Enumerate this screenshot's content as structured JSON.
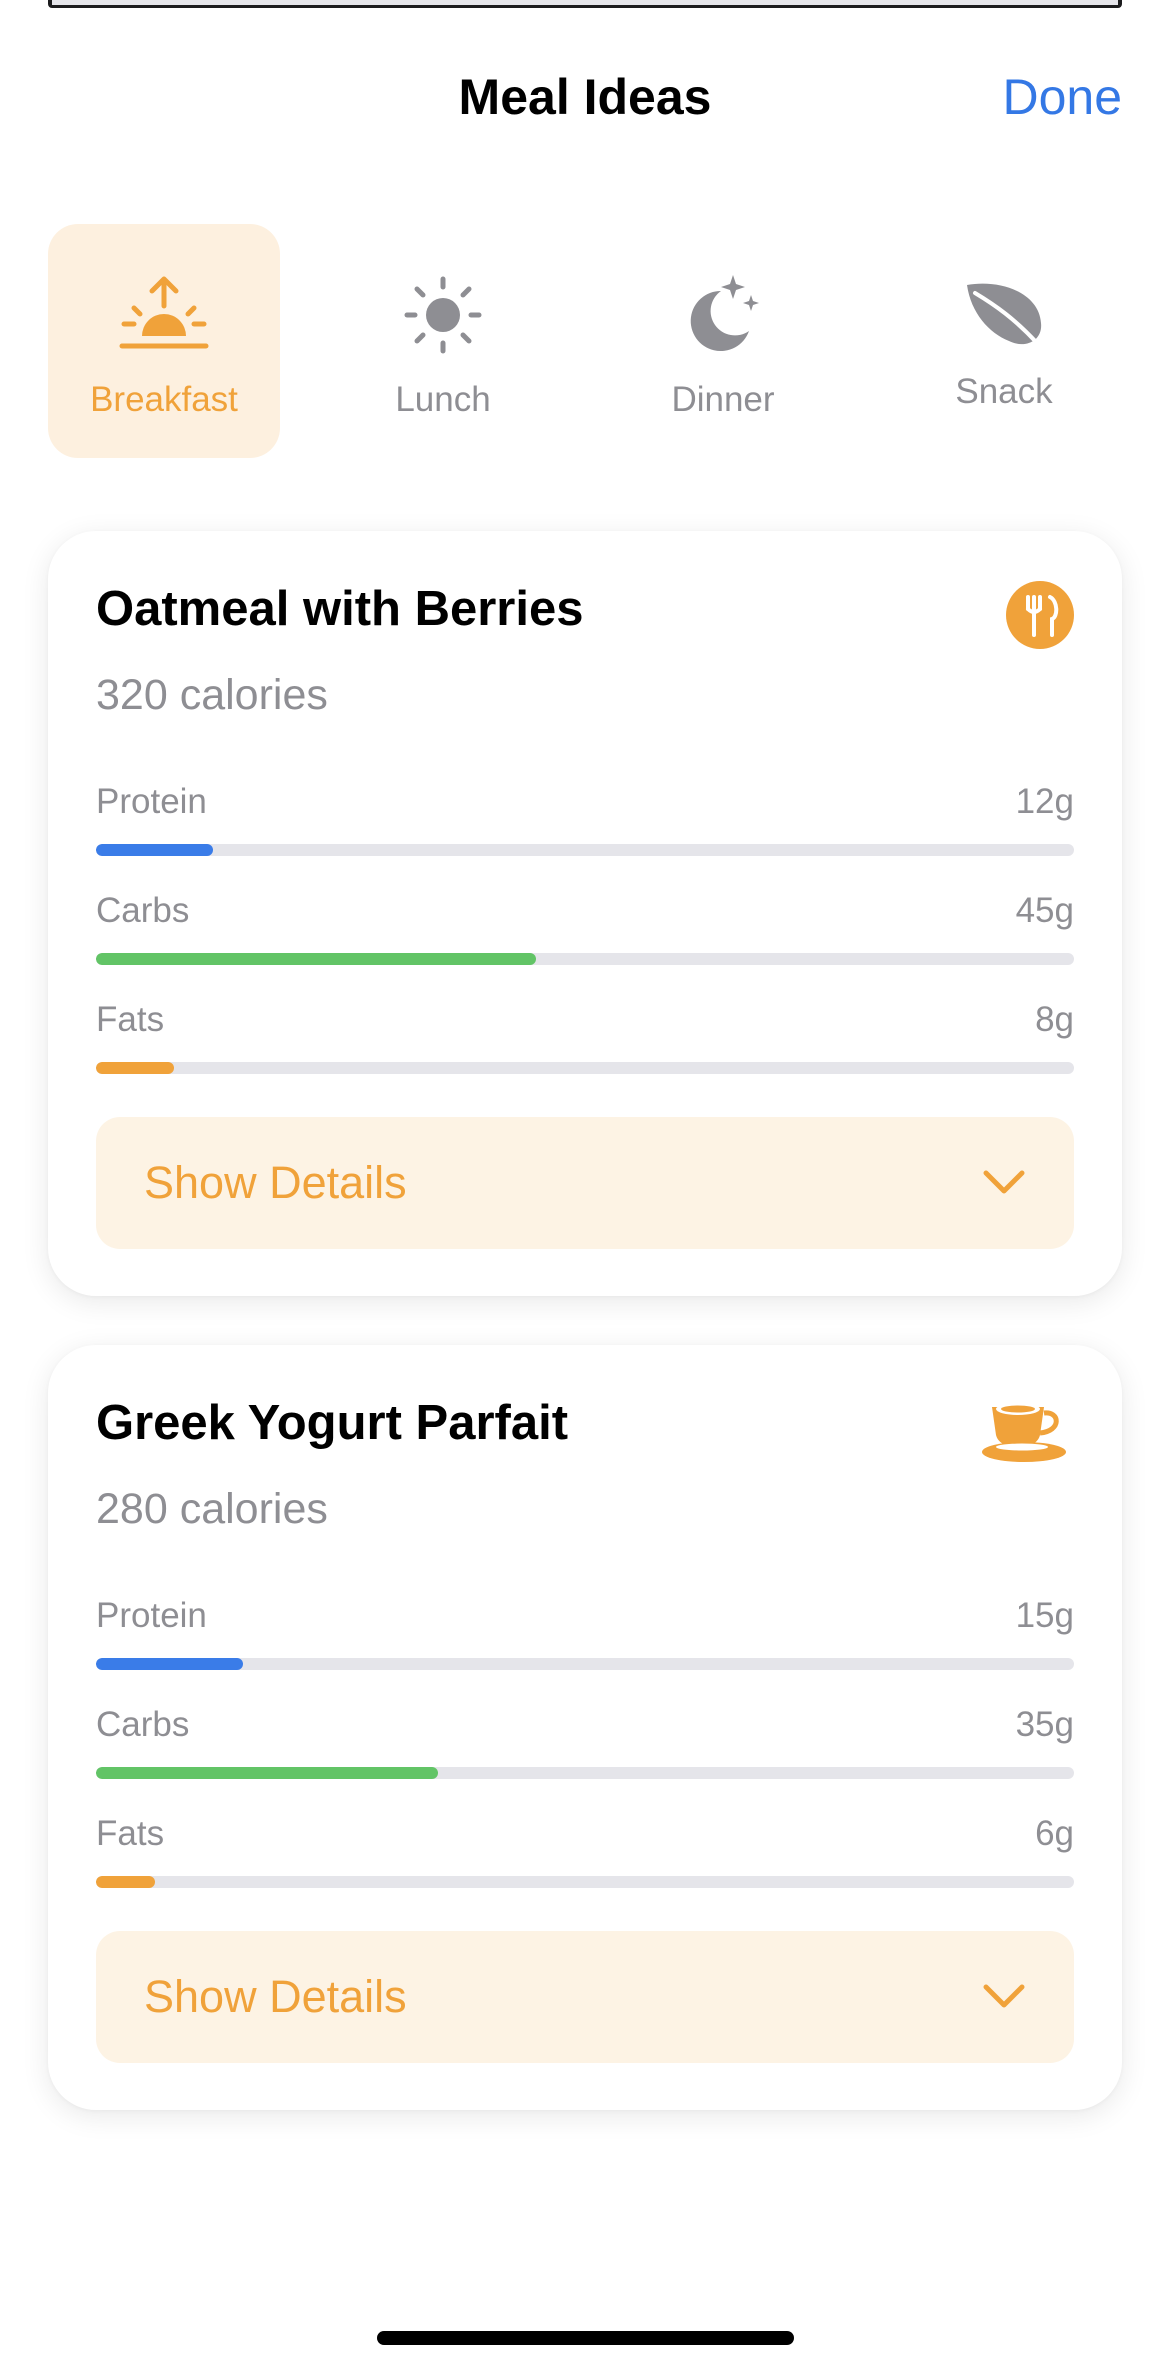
{
  "header": {
    "title": "Meal Ideas",
    "done_label": "Done"
  },
  "tabs": [
    {
      "label": "Breakfast",
      "icon": "sunrise-icon",
      "active": true
    },
    {
      "label": "Lunch",
      "icon": "sun-icon",
      "active": false
    },
    {
      "label": "Dinner",
      "icon": "moon-stars-icon",
      "active": false
    },
    {
      "label": "Snack",
      "icon": "leaf-icon",
      "active": false
    }
  ],
  "meals": [
    {
      "name": "Oatmeal with Berries",
      "calories": "320 calories",
      "icon": "fork-knife-icon",
      "macros": [
        {
          "label": "Protein",
          "value": "12g",
          "fraction": 0.12
        },
        {
          "label": "Carbs",
          "value": "45g",
          "fraction": 0.45
        },
        {
          "label": "Fats",
          "value": "8g",
          "fraction": 0.08
        }
      ],
      "details_label": "Show Details"
    },
    {
      "name": "Greek Yogurt Parfait",
      "calories": "280 calories",
      "icon": "cup-saucer-icon",
      "macros": [
        {
          "label": "Protein",
          "value": "15g",
          "fraction": 0.15
        },
        {
          "label": "Carbs",
          "value": "35g",
          "fraction": 0.35
        },
        {
          "label": "Fats",
          "value": "6g",
          "fraction": 0.06
        }
      ],
      "details_label": "Show Details"
    }
  ],
  "colors": {
    "accent": "#f0a23a",
    "link": "#3478e5",
    "protein": "#3a7ce8",
    "carbs": "#62c466",
    "fats": "#f0a23a",
    "muted": "#8e8e93"
  }
}
